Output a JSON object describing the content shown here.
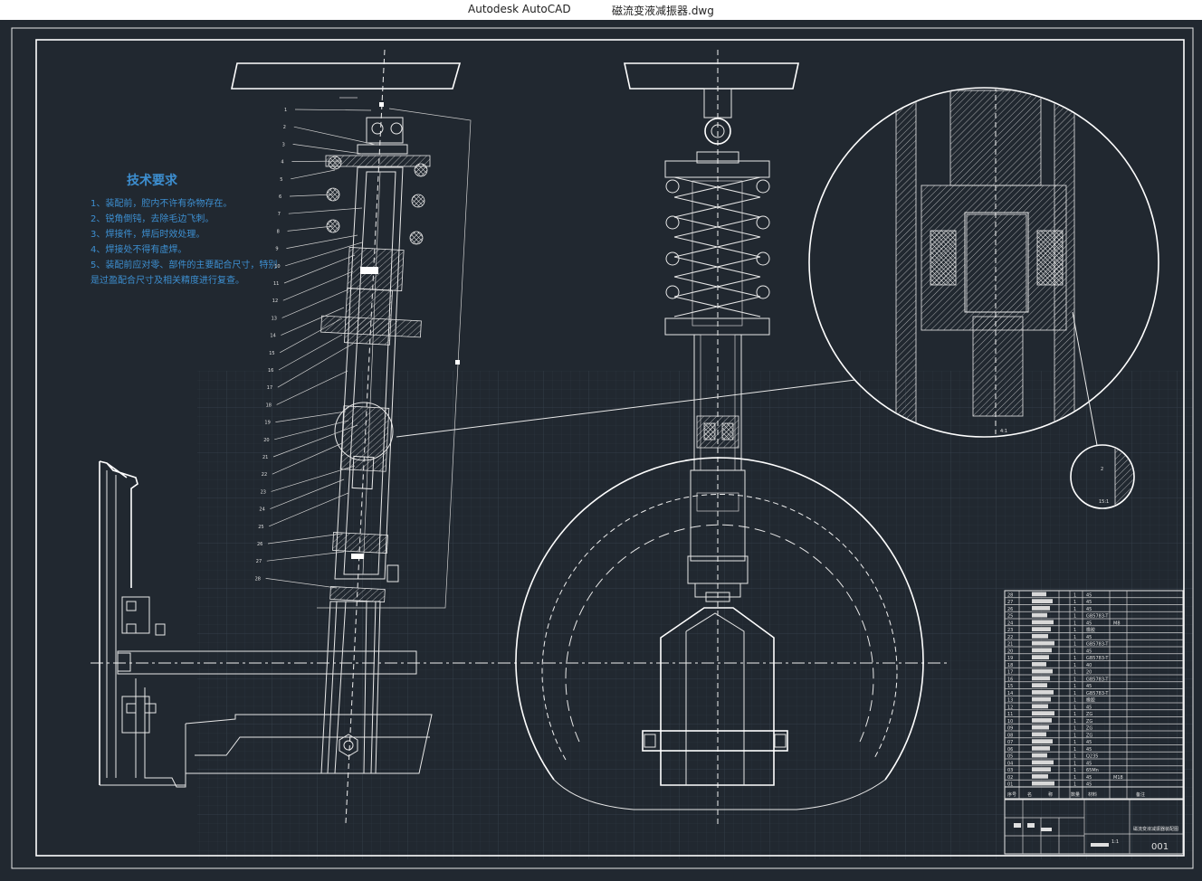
{
  "window": {
    "app_name": "Autodesk AutoCAD",
    "file_name": "磁流变液减振器.dwg"
  },
  "notes": {
    "title": "技术要求",
    "items": [
      "1、装配前，腔内不许有杂物存在。",
      "2、锐角倒钝，去除毛边飞刺。",
      "3、焊接件，焊后时效处理。",
      "4、焊接处不得有虚焊。",
      "5、装配前应对零、部件的主要配合尺寸，特别",
      "是过盈配合尺寸及相关精度进行复查。"
    ]
  },
  "balloons": [
    "1",
    "2",
    "3",
    "4",
    "5",
    "6",
    "7",
    "8",
    "9",
    "10",
    "11",
    "12",
    "13",
    "14",
    "15",
    "16",
    "17",
    "18",
    "19",
    "20",
    "21",
    "22",
    "23",
    "24",
    "25",
    "26",
    "27",
    "28"
  ],
  "detail": {
    "scale_a": "4:1",
    "scale_b": "15:1",
    "dim_b": "2"
  },
  "parts_table": {
    "rows": [
      {
        "no": "28",
        "qty": "1",
        "material": "45",
        "note": ""
      },
      {
        "no": "27",
        "qty": "1",
        "material": "45",
        "note": ""
      },
      {
        "no": "26",
        "qty": "1",
        "material": "45",
        "note": ""
      },
      {
        "no": "25",
        "qty": "1",
        "material": "GB5783-T",
        "note": ""
      },
      {
        "no": "24",
        "qty": "1",
        "material": "45",
        "note": "M8"
      },
      {
        "no": "23",
        "qty": "1",
        "material": "橡胶",
        "note": ""
      },
      {
        "no": "22",
        "qty": "1",
        "material": "45",
        "note": ""
      },
      {
        "no": "21",
        "qty": "1",
        "material": "GB5783-T",
        "note": ""
      },
      {
        "no": "20",
        "qty": "1",
        "material": "45",
        "note": ""
      },
      {
        "no": "19",
        "qty": "1",
        "material": "GB5783-T",
        "note": ""
      },
      {
        "no": "18",
        "qty": "1",
        "material": "40",
        "note": ""
      },
      {
        "no": "17",
        "qty": "1",
        "material": "20",
        "note": ""
      },
      {
        "no": "16",
        "qty": "1",
        "material": "GB5783-T",
        "note": ""
      },
      {
        "no": "15",
        "qty": "1",
        "material": "45",
        "note": ""
      },
      {
        "no": "14",
        "qty": "1",
        "material": "GB5783-T",
        "note": ""
      },
      {
        "no": "13",
        "qty": "1",
        "material": "橡胶",
        "note": ""
      },
      {
        "no": "12",
        "qty": "1",
        "material": "45",
        "note": ""
      },
      {
        "no": "11",
        "qty": "1",
        "material": "ZG",
        "note": ""
      },
      {
        "no": "10",
        "qty": "1",
        "material": "ZG",
        "note": ""
      },
      {
        "no": "09",
        "qty": "1",
        "material": "ZG",
        "note": ""
      },
      {
        "no": "08",
        "qty": "1",
        "material": "ZG",
        "note": ""
      },
      {
        "no": "07",
        "qty": "1",
        "material": "45",
        "note": ""
      },
      {
        "no": "06",
        "qty": "1",
        "material": "45",
        "note": ""
      },
      {
        "no": "05",
        "qty": "1",
        "material": "Q235",
        "note": ""
      },
      {
        "no": "04",
        "qty": "1",
        "material": "45",
        "note": ""
      },
      {
        "no": "03",
        "qty": "1",
        "material": "65Mn",
        "note": ""
      },
      {
        "no": "02",
        "qty": "1",
        "material": "45",
        "note": "M18"
      },
      {
        "no": "01",
        "qty": "1",
        "material": "45",
        "note": ""
      }
    ],
    "header": [
      "序号",
      "名",
      "称",
      "数量",
      "材料",
      "备注"
    ],
    "drawing_no": "001",
    "scale": "1:1",
    "title": "磁流变液减振器装配图"
  },
  "colors": {
    "background": "#212830",
    "line": "#e8e8e8",
    "notes": "#3d8fd1",
    "grid": "#2e3742"
  }
}
